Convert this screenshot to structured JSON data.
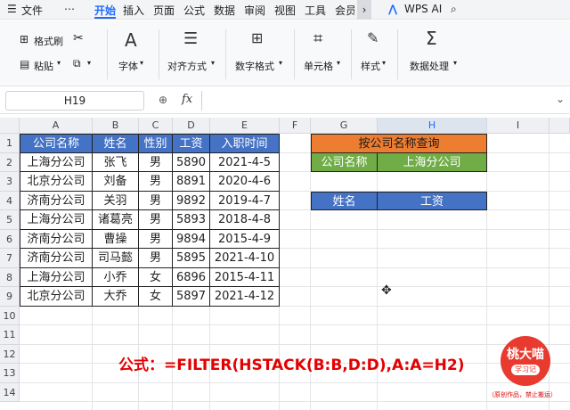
{
  "menubar": {
    "items": [
      "文件",
      "⋯",
      "开始",
      "插入",
      "页面",
      "公式",
      "数据",
      "审阅",
      "视图",
      "工具",
      "会员"
    ],
    "active": "开始",
    "wps_ai": "WPS AI"
  },
  "ribbon": {
    "format_painter": "格式刷",
    "paste": "粘贴",
    "font": "字体",
    "align": "对齐方式",
    "number_format": "数字格式",
    "cell": "单元格",
    "style": "样式",
    "data_process": "数据处理"
  },
  "formula_bar": {
    "name_box": "H19",
    "fx": "fx",
    "value": ""
  },
  "columns": [
    "A",
    "B",
    "C",
    "D",
    "E",
    "F",
    "G",
    "H",
    "I"
  ],
  "rows": [
    "1",
    "2",
    "3",
    "4",
    "5",
    "6",
    "7",
    "8",
    "9",
    "10",
    "11",
    "12",
    "13",
    "14"
  ],
  "table": {
    "headers": [
      "公司名称",
      "姓名",
      "性别",
      "工资",
      "入职时间"
    ],
    "rows": [
      [
        "上海分公司",
        "张飞",
        "男",
        "5890",
        "2021-4-5"
      ],
      [
        "北京分公司",
        "刘备",
        "男",
        "8891",
        "2020-4-6"
      ],
      [
        "济南分公司",
        "关羽",
        "男",
        "9892",
        "2019-4-7"
      ],
      [
        "上海分公司",
        "诸葛亮",
        "男",
        "5893",
        "2018-4-8"
      ],
      [
        "济南分公司",
        "曹操",
        "男",
        "9894",
        "2015-4-9"
      ],
      [
        "济南分公司",
        "司马懿",
        "男",
        "5895",
        "2021-4-10"
      ],
      [
        "上海分公司",
        "小乔",
        "女",
        "6896",
        "2015-4-11"
      ],
      [
        "北京分公司",
        "大乔",
        "女",
        "5897",
        "2021-4-12"
      ]
    ]
  },
  "query": {
    "title": "按公司名称查询",
    "label": "公司名称",
    "value": "上海分公司",
    "result_headers": [
      "姓名",
      "工资"
    ]
  },
  "formula_note": "公式：=FILTER(HSTACK(B:B,D:D),A:A=H2)",
  "badge": {
    "line1": "桃大喵",
    "line2": "学习记",
    "note": "（原创作品，禁止搬运）"
  },
  "colors": {
    "header_blue": "#4472c4",
    "title_orange": "#ed7d31",
    "value_green": "#70ad47",
    "accent": "#1f6bff",
    "formula_red": "#e30000"
  }
}
